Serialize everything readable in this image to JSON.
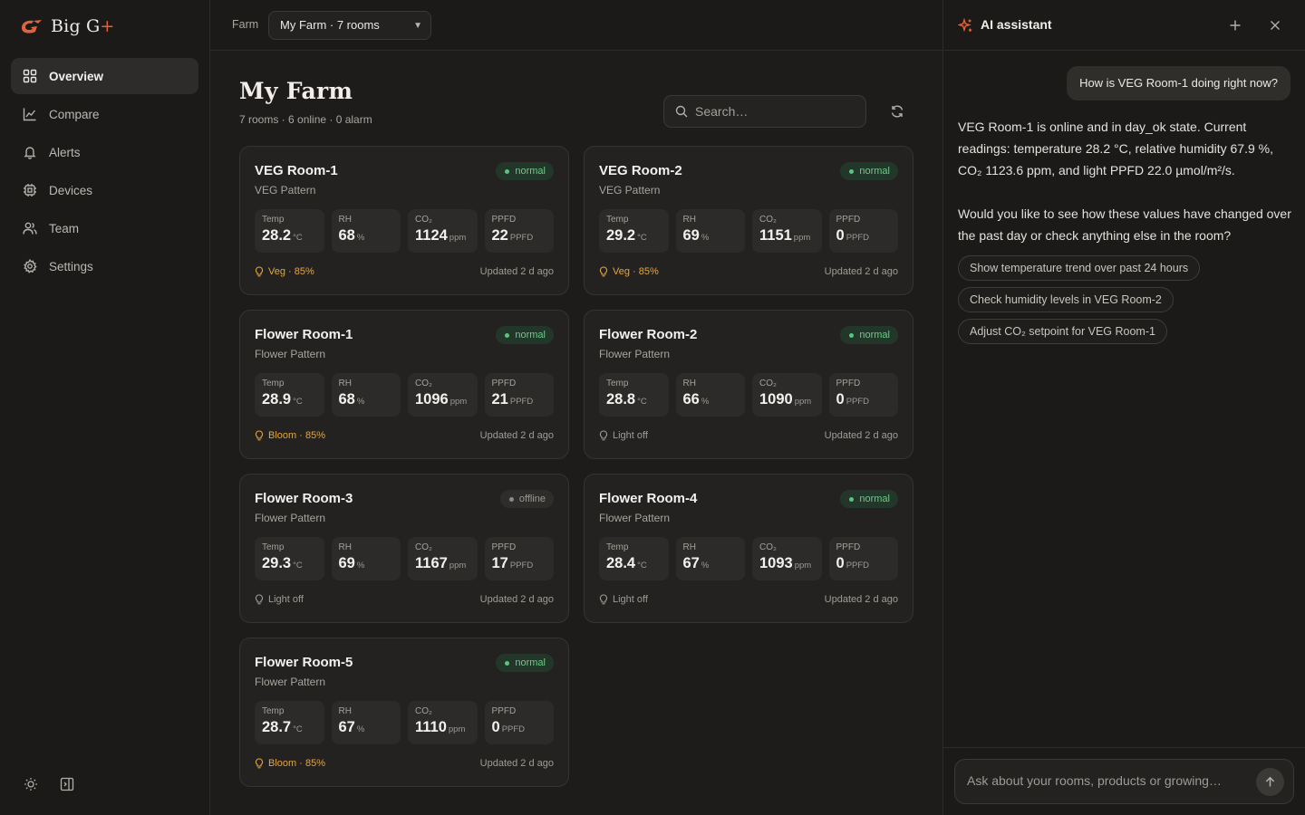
{
  "brand": {
    "name": "Big G",
    "plus": "+"
  },
  "sidebar": {
    "items": [
      {
        "label": "Overview",
        "icon": "grid-icon"
      },
      {
        "label": "Compare",
        "icon": "chart-line-icon"
      },
      {
        "label": "Alerts",
        "icon": "bell-icon"
      },
      {
        "label": "Devices",
        "icon": "chip-icon"
      },
      {
        "label": "Team",
        "icon": "users-icon"
      },
      {
        "label": "Settings",
        "icon": "gear-icon"
      }
    ]
  },
  "topbar": {
    "farm_label": "Farm",
    "farm_selected": "My Farm · 7 rooms"
  },
  "main": {
    "title": "My Farm",
    "subtitle": "7 rooms · 6 online · 0 alarm",
    "search_placeholder": "Search…"
  },
  "metric_labels": {
    "temp": "Temp",
    "rh": "RH",
    "co2": "CO₂",
    "ppfd": "PPFD"
  },
  "metric_units": {
    "temp": "°C",
    "rh": "%",
    "co2": "ppm",
    "ppfd": "PPFD"
  },
  "rooms": [
    {
      "name": "VEG Room-1",
      "pattern": "VEG Pattern",
      "status": "normal",
      "temp": "28.2",
      "rh": "68",
      "co2": "1124",
      "ppfd": "22",
      "light": "Veg · 85%",
      "light_on": true,
      "updated": "Updated 2 d ago"
    },
    {
      "name": "VEG Room-2",
      "pattern": "VEG Pattern",
      "status": "normal",
      "temp": "29.2",
      "rh": "69",
      "co2": "1151",
      "ppfd": "0",
      "light": "Veg · 85%",
      "light_on": true,
      "updated": "Updated 2 d ago"
    },
    {
      "name": "Flower Room-1",
      "pattern": "Flower Pattern",
      "status": "normal",
      "temp": "28.9",
      "rh": "68",
      "co2": "1096",
      "ppfd": "21",
      "light": "Bloom · 85%",
      "light_on": true,
      "updated": "Updated 2 d ago"
    },
    {
      "name": "Flower Room-2",
      "pattern": "Flower Pattern",
      "status": "normal",
      "temp": "28.8",
      "rh": "66",
      "co2": "1090",
      "ppfd": "0",
      "light": "Light off",
      "light_on": false,
      "updated": "Updated 2 d ago"
    },
    {
      "name": "Flower Room-3",
      "pattern": "Flower Pattern",
      "status": "offline",
      "temp": "29.3",
      "rh": "69",
      "co2": "1167",
      "ppfd": "17",
      "light": "Light off",
      "light_on": false,
      "updated": "Updated 2 d ago"
    },
    {
      "name": "Flower Room-4",
      "pattern": "Flower Pattern",
      "status": "normal",
      "temp": "28.4",
      "rh": "67",
      "co2": "1093",
      "ppfd": "0",
      "light": "Light off",
      "light_on": false,
      "updated": "Updated 2 d ago"
    },
    {
      "name": "Flower Room-5",
      "pattern": "Flower Pattern",
      "status": "normal",
      "temp": "28.7",
      "rh": "67",
      "co2": "1110",
      "ppfd": "0",
      "light": "Bloom · 85%",
      "light_on": true,
      "updated": "Updated 2 d ago"
    }
  ],
  "assistant": {
    "title": "AI assistant",
    "user_message": "How is VEG Room-1 doing right now?",
    "bot_message_1": "VEG Room-1 is online and in day_ok state. Current readings: temperature 28.2 °C, relative humidity 67.9 %, CO₂ 1123.6 ppm, and light PPFD 22.0 µmol/m²/s.",
    "bot_message_2": "Would you like to see how these values have changed over the past day or check anything else in the room?",
    "suggestions": [
      "Show temperature trend over past 24 hours",
      "Check humidity levels in VEG Room-2",
      "Adjust CO₂ setpoint for VEG Room-1"
    ],
    "input_placeholder": "Ask about your rooms, products or growing…"
  },
  "colors": {
    "accent": "#e0643a",
    "status_normal": "#5cc57c",
    "light_on": "#e3a53f"
  }
}
